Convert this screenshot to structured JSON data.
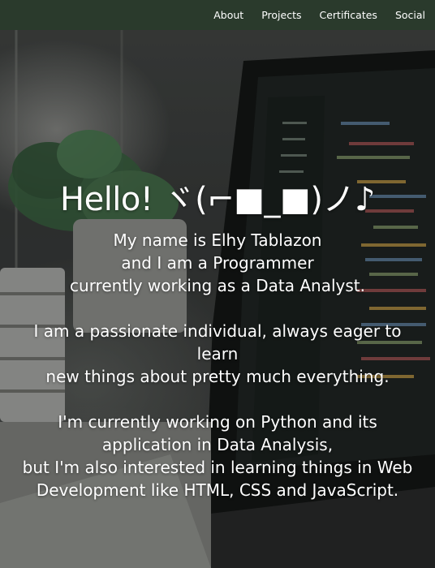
{
  "nav": {
    "items": [
      {
        "label": "About"
      },
      {
        "label": "Projects"
      },
      {
        "label": "Certificates"
      },
      {
        "label": "Social"
      }
    ]
  },
  "hero": {
    "title": "Hello! ヾ(⌐■_■)ノ♪",
    "intro_lines": [
      "My name is Elhy Tablazon",
      "and I am a Programmer",
      "currently working as a Data Analyst."
    ],
    "passion_lines": [
      "I am a passionate individual, always eager to learn",
      "new things about pretty much everything."
    ],
    "current_lines": [
      "I'm currently working on Python and its application in Data Analysis,",
      "but I'm also interested in learning things in Web Development like HTML, CSS and JavaScript."
    ]
  },
  "colors": {
    "nav_background": "#2a3a2c",
    "text": "#ffffff"
  }
}
